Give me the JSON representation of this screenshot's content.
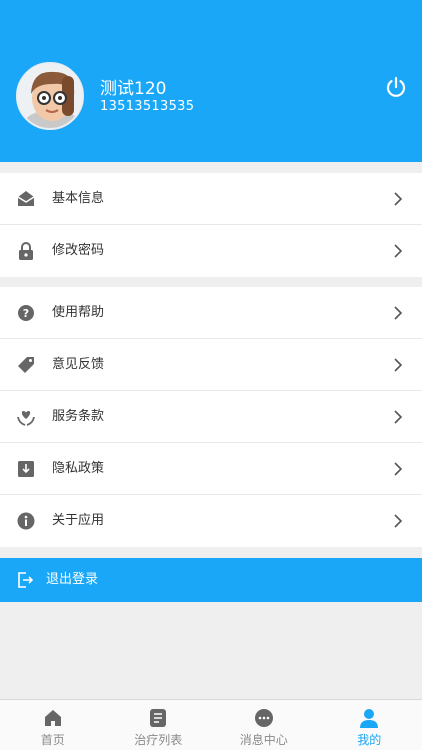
{
  "profile": {
    "name": "测试120",
    "phone": "13513513535"
  },
  "menu_group_1": [
    {
      "label": "基本信息",
      "icon": "envelope-open-icon"
    },
    {
      "label": "修改密码",
      "icon": "lock-icon"
    }
  ],
  "menu_group_2": [
    {
      "label": "使用帮助",
      "icon": "question-icon"
    },
    {
      "label": "意见反馈",
      "icon": "tag-icon"
    },
    {
      "label": "服务条款",
      "icon": "heart-hands-icon"
    },
    {
      "label": "隐私政策",
      "icon": "privacy-icon"
    },
    {
      "label": "关于应用",
      "icon": "info-icon"
    }
  ],
  "logout": {
    "label": "退出登录"
  },
  "tabs": [
    {
      "label": "首页",
      "icon": "home-icon",
      "active": false
    },
    {
      "label": "治疗列表",
      "icon": "list-icon",
      "active": false
    },
    {
      "label": "消息中心",
      "icon": "message-icon",
      "active": false
    },
    {
      "label": "我的",
      "icon": "user-icon",
      "active": true
    }
  ],
  "colors": {
    "accent": "#1aa7f7",
    "icon_gray": "#666666",
    "page_bg": "#efefef"
  }
}
